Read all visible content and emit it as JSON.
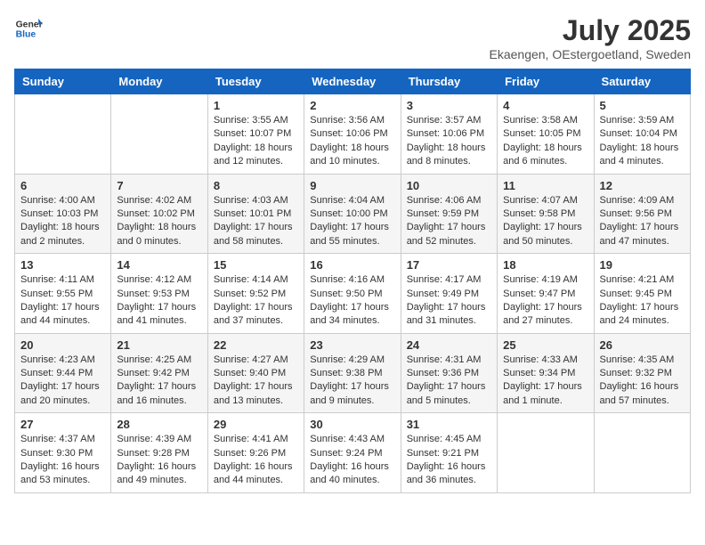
{
  "header": {
    "logo_general": "General",
    "logo_blue": "Blue",
    "month_title": "July 2025",
    "location": "Ekaengen, OEstergoetland, Sweden"
  },
  "weekdays": [
    "Sunday",
    "Monday",
    "Tuesday",
    "Wednesday",
    "Thursday",
    "Friday",
    "Saturday"
  ],
  "weeks": [
    [
      {
        "day": "",
        "info": ""
      },
      {
        "day": "",
        "info": ""
      },
      {
        "day": "1",
        "info": "Sunrise: 3:55 AM\nSunset: 10:07 PM\nDaylight: 18 hours\nand 12 minutes."
      },
      {
        "day": "2",
        "info": "Sunrise: 3:56 AM\nSunset: 10:06 PM\nDaylight: 18 hours\nand 10 minutes."
      },
      {
        "day": "3",
        "info": "Sunrise: 3:57 AM\nSunset: 10:06 PM\nDaylight: 18 hours\nand 8 minutes."
      },
      {
        "day": "4",
        "info": "Sunrise: 3:58 AM\nSunset: 10:05 PM\nDaylight: 18 hours\nand 6 minutes."
      },
      {
        "day": "5",
        "info": "Sunrise: 3:59 AM\nSunset: 10:04 PM\nDaylight: 18 hours\nand 4 minutes."
      }
    ],
    [
      {
        "day": "6",
        "info": "Sunrise: 4:00 AM\nSunset: 10:03 PM\nDaylight: 18 hours\nand 2 minutes."
      },
      {
        "day": "7",
        "info": "Sunrise: 4:02 AM\nSunset: 10:02 PM\nDaylight: 18 hours\nand 0 minutes."
      },
      {
        "day": "8",
        "info": "Sunrise: 4:03 AM\nSunset: 10:01 PM\nDaylight: 17 hours\nand 58 minutes."
      },
      {
        "day": "9",
        "info": "Sunrise: 4:04 AM\nSunset: 10:00 PM\nDaylight: 17 hours\nand 55 minutes."
      },
      {
        "day": "10",
        "info": "Sunrise: 4:06 AM\nSunset: 9:59 PM\nDaylight: 17 hours\nand 52 minutes."
      },
      {
        "day": "11",
        "info": "Sunrise: 4:07 AM\nSunset: 9:58 PM\nDaylight: 17 hours\nand 50 minutes."
      },
      {
        "day": "12",
        "info": "Sunrise: 4:09 AM\nSunset: 9:56 PM\nDaylight: 17 hours\nand 47 minutes."
      }
    ],
    [
      {
        "day": "13",
        "info": "Sunrise: 4:11 AM\nSunset: 9:55 PM\nDaylight: 17 hours\nand 44 minutes."
      },
      {
        "day": "14",
        "info": "Sunrise: 4:12 AM\nSunset: 9:53 PM\nDaylight: 17 hours\nand 41 minutes."
      },
      {
        "day": "15",
        "info": "Sunrise: 4:14 AM\nSunset: 9:52 PM\nDaylight: 17 hours\nand 37 minutes."
      },
      {
        "day": "16",
        "info": "Sunrise: 4:16 AM\nSunset: 9:50 PM\nDaylight: 17 hours\nand 34 minutes."
      },
      {
        "day": "17",
        "info": "Sunrise: 4:17 AM\nSunset: 9:49 PM\nDaylight: 17 hours\nand 31 minutes."
      },
      {
        "day": "18",
        "info": "Sunrise: 4:19 AM\nSunset: 9:47 PM\nDaylight: 17 hours\nand 27 minutes."
      },
      {
        "day": "19",
        "info": "Sunrise: 4:21 AM\nSunset: 9:45 PM\nDaylight: 17 hours\nand 24 minutes."
      }
    ],
    [
      {
        "day": "20",
        "info": "Sunrise: 4:23 AM\nSunset: 9:44 PM\nDaylight: 17 hours\nand 20 minutes."
      },
      {
        "day": "21",
        "info": "Sunrise: 4:25 AM\nSunset: 9:42 PM\nDaylight: 17 hours\nand 16 minutes."
      },
      {
        "day": "22",
        "info": "Sunrise: 4:27 AM\nSunset: 9:40 PM\nDaylight: 17 hours\nand 13 minutes."
      },
      {
        "day": "23",
        "info": "Sunrise: 4:29 AM\nSunset: 9:38 PM\nDaylight: 17 hours\nand 9 minutes."
      },
      {
        "day": "24",
        "info": "Sunrise: 4:31 AM\nSunset: 9:36 PM\nDaylight: 17 hours\nand 5 minutes."
      },
      {
        "day": "25",
        "info": "Sunrise: 4:33 AM\nSunset: 9:34 PM\nDaylight: 17 hours\nand 1 minute."
      },
      {
        "day": "26",
        "info": "Sunrise: 4:35 AM\nSunset: 9:32 PM\nDaylight: 16 hours\nand 57 minutes."
      }
    ],
    [
      {
        "day": "27",
        "info": "Sunrise: 4:37 AM\nSunset: 9:30 PM\nDaylight: 16 hours\nand 53 minutes."
      },
      {
        "day": "28",
        "info": "Sunrise: 4:39 AM\nSunset: 9:28 PM\nDaylight: 16 hours\nand 49 minutes."
      },
      {
        "day": "29",
        "info": "Sunrise: 4:41 AM\nSunset: 9:26 PM\nDaylight: 16 hours\nand 44 minutes."
      },
      {
        "day": "30",
        "info": "Sunrise: 4:43 AM\nSunset: 9:24 PM\nDaylight: 16 hours\nand 40 minutes."
      },
      {
        "day": "31",
        "info": "Sunrise: 4:45 AM\nSunset: 9:21 PM\nDaylight: 16 hours\nand 36 minutes."
      },
      {
        "day": "",
        "info": ""
      },
      {
        "day": "",
        "info": ""
      }
    ]
  ]
}
